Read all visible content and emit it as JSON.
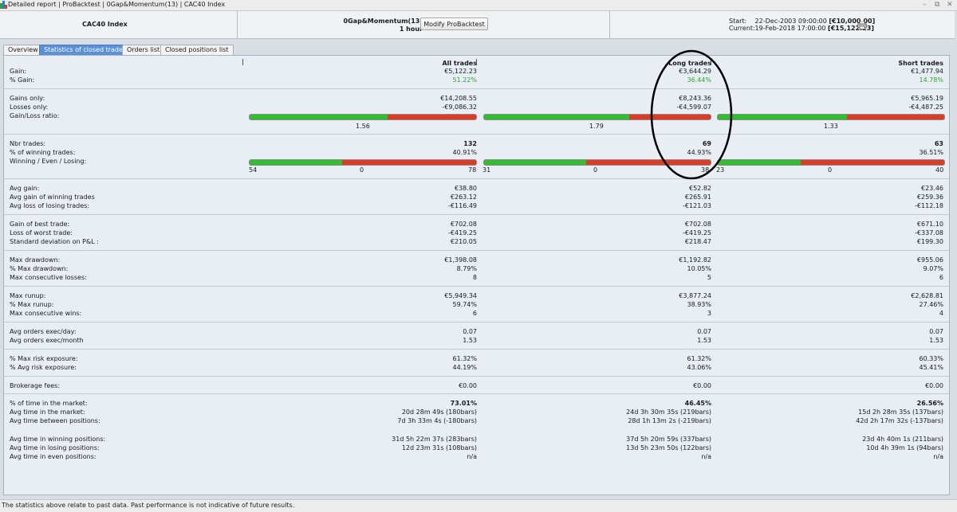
{
  "titlebar": {
    "crumbs": "Detailed report | ProBacktest | 0Gap&Momentum(13) | CAC40 Index",
    "min": "–",
    "restore": "⧉",
    "close": "✕"
  },
  "header": {
    "instrument": "CAC40 Index",
    "strategy_name": "0Gap&Momentum(13)",
    "timeframe": "1 hour",
    "modify_button": "Modify ProBacktest",
    "start_label": "Start:",
    "start_date": "22-Dec-2003 09:00:00",
    "start_capital": "[€10,000.00]",
    "current_label": "Current:",
    "current_date": "19-Feb-2018 17:00:00",
    "current_capital": "[€15,122.23]"
  },
  "tabs": [
    "Overview",
    "Statistics of closed trades",
    "Orders list",
    "Closed positions list"
  ],
  "columns": {
    "all": "All trades",
    "long": "Long trades",
    "short": "Short trades"
  },
  "rows": {
    "gain": {
      "label": "Gain:",
      "all": "€5,122.23",
      "long": "€3,644.29",
      "short": "€1,477.94"
    },
    "pct_gain": {
      "label": "% Gain:",
      "all": "51.22%",
      "long": "36.44%",
      "short": "14.78%"
    },
    "gains_only": {
      "label": "Gains only:",
      "all": "€14,208.55",
      "long": "€8,243.36",
      "short": "€5,965.19"
    },
    "losses_only": {
      "label": "Losses only:",
      "all": "-€9,086.32",
      "long": "-€4,599.07",
      "short": "-€4,487.25"
    },
    "gain_loss_ratio": {
      "label": "Gain/Loss ratio:",
      "all": "1.56",
      "long": "1.79",
      "short": "1.33"
    },
    "nbr_trades": {
      "label": "Nbr trades:",
      "all": "132",
      "long": "69",
      "short": "63"
    },
    "pct_winning": {
      "label": "% of winning trades:",
      "all": "40.91%",
      "long": "44.93%",
      "short": "36.51%"
    },
    "wel": {
      "label": "Winning / Even / Losing:",
      "all": {
        "win": "54",
        "even": "0",
        "lose": "78"
      },
      "long": {
        "win": "31",
        "even": "0",
        "lose": "38"
      },
      "short": {
        "win": "23",
        "even": "0",
        "lose": "40"
      }
    },
    "avg_gain": {
      "label": "Avg gain:",
      "all": "€38.80",
      "long": "€52.82",
      "short": "€23.46"
    },
    "avg_gain_win": {
      "label": "Avg gain of winning trades",
      "all": "€263.12",
      "long": "€265.91",
      "short": "€259.36"
    },
    "avg_loss_lose": {
      "label": "Avg loss of losing trades:",
      "all": "-€116.49",
      "long": "-€121.03",
      "short": "-€112.18"
    },
    "best": {
      "label": "Gain of best trade:",
      "all": "€702.08",
      "long": "€702.08",
      "short": "€671.10"
    },
    "worst": {
      "label": "Loss of worst trade:",
      "all": "-€419.25",
      "long": "-€419.25",
      "short": "-€337.08"
    },
    "stdev": {
      "label": "Standard deviation on P&L :",
      "all": "€210.05",
      "long": "€218.47",
      "short": "€199.30"
    },
    "max_dd": {
      "label": "Max drawdown:",
      "all": "€1,398.08",
      "long": "€1,192.82",
      "short": "€955.06"
    },
    "pct_max_dd": {
      "label": "% Max drawdown:",
      "all": "8.79%",
      "long": "10.05%",
      "short": "9.07%"
    },
    "max_consec_losses": {
      "label": "Max consecutive losses:",
      "all": "8",
      "long": "5",
      "short": "6"
    },
    "max_runup": {
      "label": "Max runup:",
      "all": "€5,949.34",
      "long": "€3,877.24",
      "short": "€2,628.81"
    },
    "pct_max_runup": {
      "label": "% Max runup:",
      "all": "59.74%",
      "long": "38.93%",
      "short": "27.46%"
    },
    "max_consec_wins": {
      "label": "Max consecutive wins:",
      "all": "6",
      "long": "3",
      "short": "4"
    },
    "orders_day": {
      "label": "Avg orders exec/day:",
      "all": "0.07",
      "long": "0.07",
      "short": "0.07"
    },
    "orders_month": {
      "label": "Avg orders exec/month",
      "all": "1.53",
      "long": "1.53",
      "short": "1.53"
    },
    "max_risk": {
      "label": "% Max risk exposure:",
      "all": "61.32%",
      "long": "61.32%",
      "short": "60.33%"
    },
    "avg_risk": {
      "label": "% Avg risk exposure:",
      "all": "44.19%",
      "long": "43.06%",
      "short": "45.41%"
    },
    "brokerage": {
      "label": "Brokerage fees:",
      "all": "€0.00",
      "long": "€0.00",
      "short": "€0.00"
    },
    "pct_time": {
      "label": "% of time in the market:",
      "all": "73.01%",
      "long": "46.45%",
      "short": "26.56%"
    },
    "avg_time_market": {
      "label": "Avg time in the market:",
      "all": "20d 28m 49s (180bars)",
      "long": "24d 3h 30m 35s (219bars)",
      "short": "15d 2h 28m 35s (137bars)"
    },
    "avg_time_between": {
      "label": "Avg time between positions:",
      "all": "7d 3h 33m 4s (-180bars)",
      "long": "28d 1h 13m 2s (-219bars)",
      "short": "42d 2h 17m 32s (-137bars)"
    },
    "avg_time_win": {
      "label": "Avg time in winning positions:",
      "all": "31d 5h 22m 37s (283bars)",
      "long": "37d 5h 20m 59s (337bars)",
      "short": "23d 4h 40m 1s (211bars)"
    },
    "avg_time_lose": {
      "label": "Avg time in losing positions:",
      "all": "12d 23m 31s (108bars)",
      "long": "13d 5h 23m 50s (122bars)",
      "short": "10d 4h 39m 1s (94bars)"
    },
    "avg_time_even": {
      "label": "Avg time in even positions:",
      "all": "n/a",
      "long": "n/a",
      "short": "n/a"
    }
  },
  "ratio_bars": {
    "all_green_fraction": 0.61,
    "long_green_fraction": 0.64,
    "short_green_fraction": 0.57
  },
  "footer": "The statistics above relate to past data. Past performance is not indicative of future results.",
  "colors": {
    "accent_tab": "#5b8fd6",
    "gain_green": "#2aa52a",
    "bar_green": "#2fbf2f",
    "bar_red": "#dd3b26"
  }
}
